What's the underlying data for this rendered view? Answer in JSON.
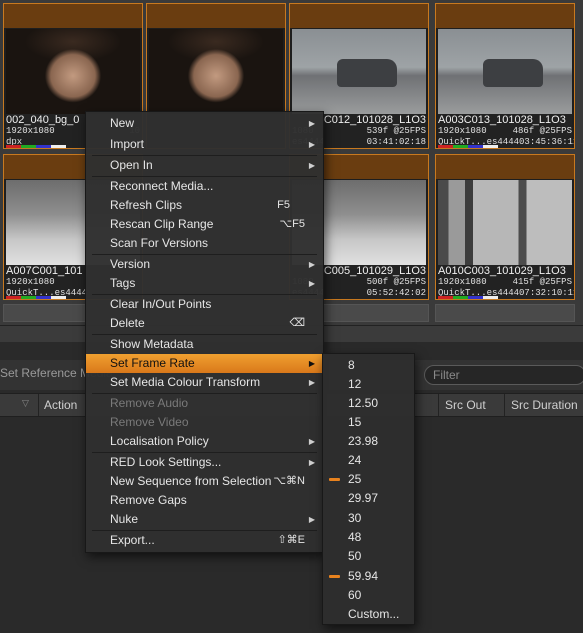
{
  "tiles": [
    {
      "name": "002_040_bg_0",
      "res": "1920x1080",
      "fps": "10",
      "codec": "dpx",
      "tc": "",
      "img": "face"
    },
    {
      "name": "",
      "res": "",
      "fps": "",
      "codec": "",
      "tc": "",
      "img": "face"
    },
    {
      "name": "C012_101028_L1O3",
      "res": "1080",
      "fps": "539f @25FPS",
      "codec": "es4444",
      "tc": "03:41:02:18",
      "img": "car"
    },
    {
      "name": "A003C013_101028_L1O3",
      "res": "1920x1080",
      "fps": "486f @25FPS",
      "codec": "QuickT...es4444",
      "tc": "03:45:36:11",
      "img": "car"
    },
    {
      "name": "A007C001_101",
      "res": "1920x1080",
      "fps": "",
      "codec": "QuickT...es4444",
      "tc": "",
      "img": "snow"
    },
    {
      "name": "C005_101029_L1O3",
      "res": "1080",
      "fps": "500f @25FPS",
      "codec": "es4444",
      "tc": "05:52:42:02",
      "img": "snow"
    },
    {
      "name": "A010C003_101029_L1O3",
      "res": "1920x1080",
      "fps": "415f @25FPS",
      "codec": "QuickT...es4444",
      "tc": "07:32:10:11",
      "img": "tree"
    }
  ],
  "toolbar": {
    "ref_button": "Set Reference Media",
    "filter_placeholder": "Filter"
  },
  "columns": {
    "action": "Action",
    "src_out": "Src Out",
    "src_duration": "Src Duration"
  },
  "menu": {
    "new": "New",
    "import": "Import",
    "open_in": "Open In",
    "reconnect": "Reconnect Media...",
    "refresh": "Refresh Clips",
    "refresh_sc": "F5",
    "rescan": "Rescan Clip Range",
    "rescan_sc": "⌥F5",
    "scan_versions": "Scan For Versions",
    "version": "Version",
    "tags": "Tags",
    "clear_inout": "Clear In/Out Points",
    "delete": "Delete",
    "delete_sc": "⌫",
    "show_metadata": "Show Metadata",
    "set_frame_rate": "Set Frame Rate",
    "set_colour": "Set Media Colour Transform",
    "remove_audio": "Remove Audio",
    "remove_video": "Remove Video",
    "localisation": "Localisation Policy",
    "red_look": "RED Look Settings...",
    "new_seq": "New Sequence from Selection",
    "new_seq_sc": "⌥⌘N",
    "remove_gaps": "Remove Gaps",
    "nuke": "Nuke",
    "export": "Export...",
    "export_sc": "⇧⌘E"
  },
  "frame_rates": [
    {
      "label": "8",
      "checked": false
    },
    {
      "label": "12",
      "checked": false
    },
    {
      "label": "12.50",
      "checked": false
    },
    {
      "label": "15",
      "checked": false
    },
    {
      "label": "23.98",
      "checked": false
    },
    {
      "label": "24",
      "checked": false
    },
    {
      "label": "25",
      "checked": true
    },
    {
      "label": "29.97",
      "checked": false
    },
    {
      "label": "30",
      "checked": false
    },
    {
      "label": "48",
      "checked": false
    },
    {
      "label": "50",
      "checked": false
    },
    {
      "label": "59.94",
      "checked": true
    },
    {
      "label": "60",
      "checked": false
    },
    {
      "label": "Custom...",
      "checked": false
    }
  ],
  "colors": {
    "accent": "#e8821e",
    "tile_border": "#c8791f"
  }
}
